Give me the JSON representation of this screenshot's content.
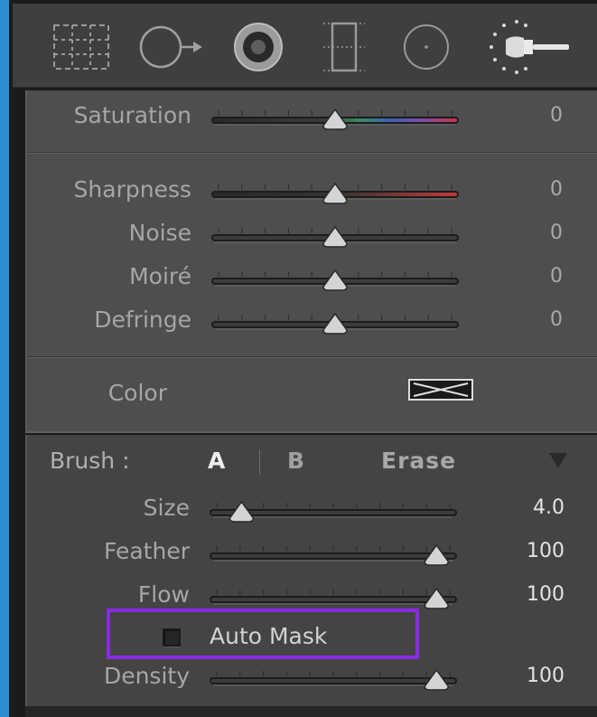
{
  "toolbar": {
    "tools": [
      {
        "name": "crop-overlay-tool-icon"
      },
      {
        "name": "spot-removal-tool-icon"
      },
      {
        "name": "red-eye-correction-tool-icon",
        "active": true
      },
      {
        "name": "graduated-filter-tool-icon"
      },
      {
        "name": "radial-filter-tool-icon"
      },
      {
        "name": "adjustment-brush-tool-icon"
      }
    ]
  },
  "adjustments": {
    "saturation": {
      "label": "Saturation",
      "value": "0"
    },
    "sharpness": {
      "label": "Sharpness",
      "value": "0"
    },
    "noise": {
      "label": "Noise",
      "value": "0"
    },
    "moire": {
      "label": "Moiré",
      "value": "0"
    },
    "defringe": {
      "label": "Defringe",
      "value": "0"
    },
    "color": {
      "label": "Color"
    }
  },
  "brush": {
    "label": "Brush :",
    "option_a": "A",
    "option_b": "B",
    "erase": "Erase",
    "size": {
      "label": "Size",
      "value": "4.0"
    },
    "feather": {
      "label": "Feather",
      "value": "100"
    },
    "flow": {
      "label": "Flow",
      "value": "100"
    },
    "auto_mask": {
      "label": "Auto Mask",
      "checked": false
    },
    "density": {
      "label": "Density",
      "value": "100"
    }
  },
  "colors": {
    "highlight": "#8a2be2",
    "panel": "#4e4e4e",
    "background": "#2b8fd6"
  }
}
